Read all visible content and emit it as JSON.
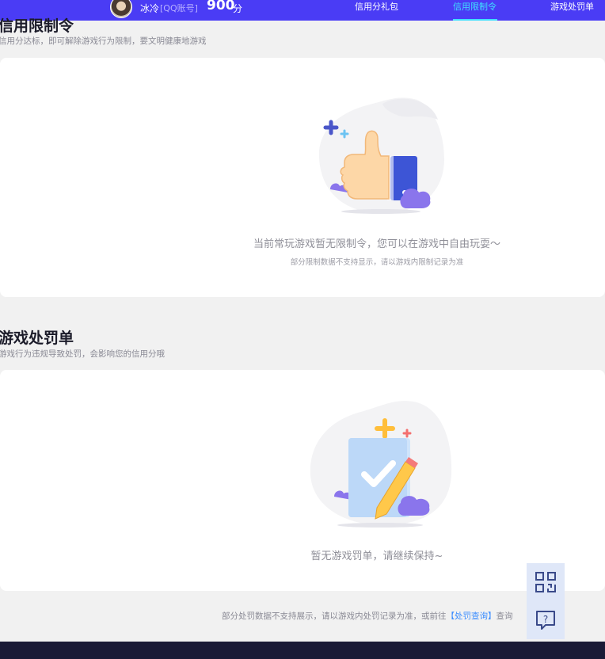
{
  "topbar": {
    "username": "冰冷",
    "account_type": "[QQ账号]",
    "score": "900",
    "score_unit": "分",
    "tabs": [
      {
        "label": "信用分礼包",
        "active": false
      },
      {
        "label": "信用限制令",
        "active": true
      },
      {
        "label": "游戏处罚单",
        "active": false
      }
    ],
    "accent_color": "#4a3cf5",
    "active_tab_color": "#3fe0ff"
  },
  "restriction": {
    "title": "信用限制令",
    "description": "信用分达标，即可解除游戏行为限制，要文明健康地游戏",
    "empty_message": "当前常玩游戏暂无限制令，您可以在游戏中自由玩耍～",
    "empty_note": "部分限制数据不支持显示，请以游戏内限制记录为准"
  },
  "penalty": {
    "title": "游戏处罚单",
    "description": "游戏行为违规导致处罚，会影响您的信用分哦",
    "empty_message": "暂无游戏罚单，请继续保持~"
  },
  "footnote": {
    "text_before": "部分处罚数据不支持展示，请以游戏内处罚记录为准，或前往",
    "link": "【处罚查询】",
    "text_after": "查询"
  },
  "fabs": {
    "qr_icon": "qr-code-icon",
    "help_icon": "help-chat-icon"
  }
}
